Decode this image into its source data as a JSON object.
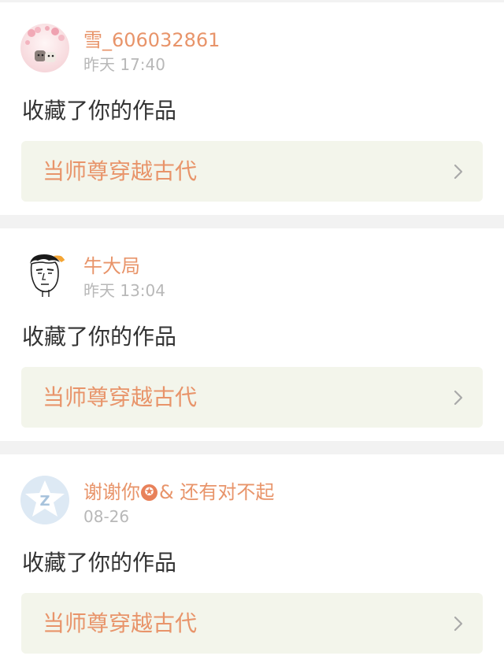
{
  "notifications": [
    {
      "username": "雪_606032861",
      "time": "昨天 17:40",
      "action": "收藏了你的作品",
      "work_title": "当师尊穿越古代",
      "avatar": "pink-blossom-avatar"
    },
    {
      "username": "牛大局",
      "time": "昨天 13:04",
      "action": "收藏了你的作品",
      "work_title": "当师尊穿越古代",
      "avatar": "cartoon-face-avatar"
    },
    {
      "username_part1": "谢谢你",
      "username_badge": "✪",
      "username_part2": "& 还有对不起",
      "time": "08-26",
      "action": "收藏了你的作品",
      "work_title": "当师尊穿越古代",
      "avatar": "default-qq-avatar"
    }
  ],
  "colors": {
    "accent": "#e8946a",
    "time_gray": "#b8b8b8",
    "card_bg": "#f3f5eb",
    "divider": "#f2f2f2"
  }
}
